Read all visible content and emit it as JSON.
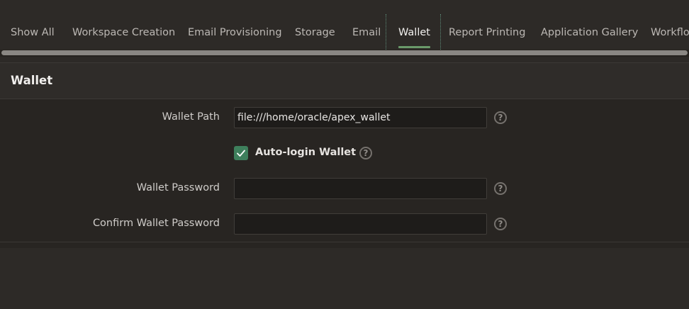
{
  "tabs": [
    {
      "label": "Show All",
      "active": false
    },
    {
      "label": "Workspace Creation",
      "active": false
    },
    {
      "label": "Email Provisioning",
      "active": false
    },
    {
      "label": "Storage",
      "active": false
    },
    {
      "label": "Email",
      "active": false
    },
    {
      "label": "Wallet",
      "active": true
    },
    {
      "label": "Report Printing",
      "active": false
    },
    {
      "label": "Application Gallery",
      "active": false
    },
    {
      "label": "Workflow",
      "active": false
    }
  ],
  "region": {
    "title": "Wallet"
  },
  "form": {
    "wallet_path": {
      "label": "Wallet Path",
      "value": "file:///home/oracle/apex_wallet"
    },
    "auto_login": {
      "label": "Auto-login Wallet",
      "checked": true
    },
    "wallet_password": {
      "label": "Wallet Password",
      "value": ""
    },
    "confirm_password": {
      "label": "Confirm Wallet Password",
      "value": ""
    },
    "help_glyph": "?"
  },
  "colors": {
    "accent": "#6a9a6a",
    "checkbox": "#3e7f5c",
    "background": "#2d2a27"
  },
  "icons": {
    "help": "help-circle-icon",
    "check": "check-icon"
  }
}
